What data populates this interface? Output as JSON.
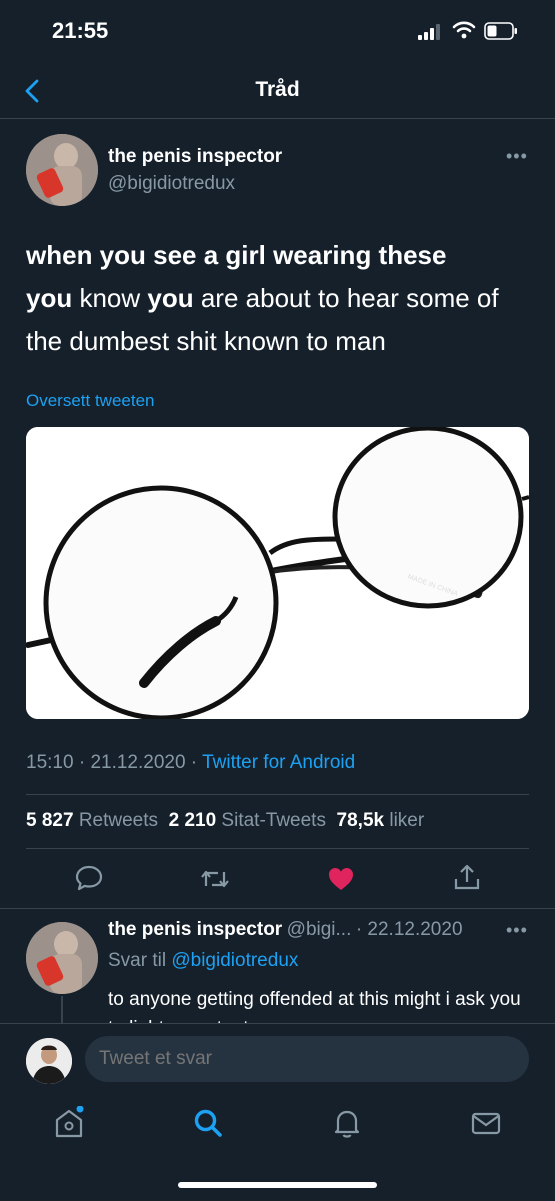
{
  "status": {
    "time": "21:55"
  },
  "nav": {
    "title": "Tråd"
  },
  "tweet": {
    "author_name": "the penis inspector",
    "author_handle": "@bigidiotredux",
    "text_line1": "when you see a girl wearing these",
    "text_you1": "you",
    "text_mid1": " know ",
    "text_you2": "you",
    "text_rest": " are about to hear some of the dumbest shit known to man",
    "translate_label": "Oversett tweeten",
    "time": "15:10",
    "date": "21.12.2020",
    "source": "Twitter for Android",
    "retweets_count": "5 827",
    "retweets_label": "Retweets",
    "quotes_count": "2 210",
    "quotes_label": "Sitat-Tweets",
    "likes_count": "78,5k",
    "likes_label": "liker",
    "liked": true,
    "media_watermark": "MADE IN CHINA"
  },
  "reply": {
    "author_name": "the penis inspector",
    "author_handle": "@bigi...",
    "date": "· 22.12.2020",
    "reply_to_label": "Svar til",
    "reply_to_handle": "@bigidiotredux",
    "text": "to anyone getting offended at this might i ask you to lighten up toots"
  },
  "compose": {
    "placeholder": "Tweet et svar"
  },
  "icons": {
    "back": "chevron-left-icon",
    "reply": "comment-icon",
    "retweet": "retweet-icon",
    "like": "heart-icon",
    "share": "share-icon",
    "home": "home-icon",
    "search": "search-icon",
    "notifications": "bell-icon",
    "messages": "mail-icon"
  },
  "colors": {
    "accent": "#1da1f2",
    "like": "#e0245e",
    "background": "#15202b",
    "secondary_text": "#8899a6"
  }
}
